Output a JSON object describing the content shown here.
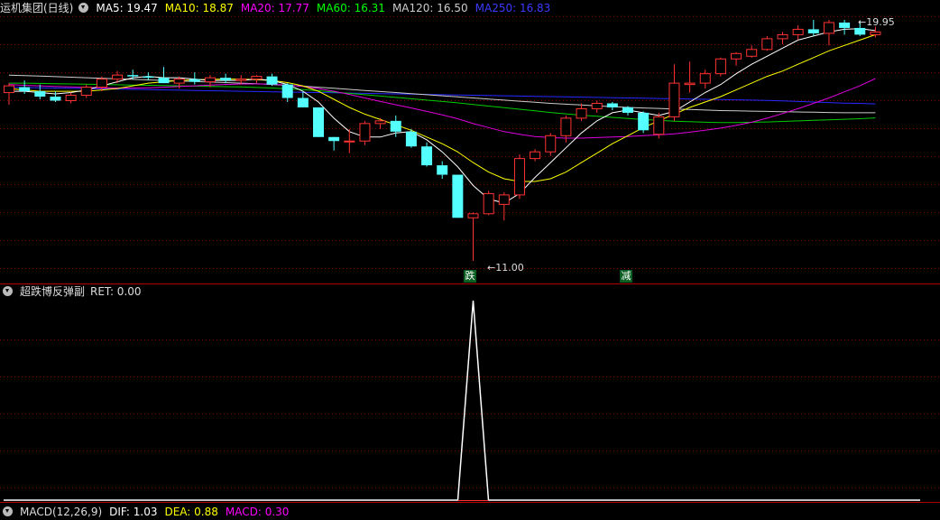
{
  "main_header": {
    "stock_name": "运机集团(日线)",
    "mas": [
      {
        "label": "MA5: 19.47",
        "color": "#ffffff"
      },
      {
        "label": "MA10: 18.87",
        "color": "#ffff00"
      },
      {
        "label": "MA20: 17.77",
        "color": "#ff00ff"
      },
      {
        "label": "MA60: 16.31",
        "color": "#00ff00"
      },
      {
        "label": "MA120: 16.50",
        "color": "#cccccc"
      },
      {
        "label": "MA250: 16.83",
        "color": "#3030ff"
      }
    ]
  },
  "annotations": {
    "high_label": "19.95",
    "low_label": "11.00",
    "signal_1": "跌",
    "signal_2": "减"
  },
  "indicator_header": {
    "name": "超跌博反弹副",
    "ret_label": "RET: 0.00"
  },
  "bottom_header": {
    "name": "MACD(12,26,9)",
    "dif": "DIF: 1.03",
    "dea": "DEA: 0.88",
    "macd": "MACD: 0.30"
  },
  "colors": {
    "up": "#ff3333",
    "down": "#54ffff",
    "grid": "#8b0000"
  },
  "candles": [
    [
      17.25,
      17.6,
      16.8,
      17.5
    ],
    [
      17.45,
      17.7,
      17.2,
      17.3
    ],
    [
      17.3,
      17.55,
      17.0,
      17.1
    ],
    [
      17.1,
      17.3,
      16.9,
      16.95
    ],
    [
      16.95,
      17.25,
      16.85,
      17.15
    ],
    [
      17.15,
      17.55,
      17.05,
      17.45
    ],
    [
      17.45,
      17.85,
      17.3,
      17.75
    ],
    [
      17.75,
      18.05,
      17.6,
      17.9
    ],
    [
      17.9,
      18.1,
      17.75,
      17.85
    ],
    [
      17.85,
      18.0,
      17.7,
      17.8
    ],
    [
      17.8,
      18.2,
      17.6,
      17.6
    ],
    [
      17.6,
      17.85,
      17.4,
      17.75
    ],
    [
      17.75,
      18.0,
      17.55,
      17.65
    ],
    [
      17.65,
      17.9,
      17.45,
      17.8
    ],
    [
      17.8,
      17.95,
      17.6,
      17.7
    ],
    [
      17.7,
      17.9,
      17.55,
      17.75
    ],
    [
      17.75,
      17.9,
      17.6,
      17.85
    ],
    [
      17.85,
      17.95,
      17.5,
      17.55
    ],
    [
      17.55,
      17.6,
      16.9,
      17.05
    ],
    [
      17.05,
      17.3,
      16.7,
      16.7
    ],
    [
      16.7,
      16.7,
      15.6,
      15.6
    ],
    [
      15.6,
      15.6,
      15.1,
      15.45
    ],
    [
      15.45,
      15.9,
      15.0,
      15.45
    ],
    [
      15.45,
      16.2,
      15.3,
      16.1
    ],
    [
      16.1,
      16.3,
      15.9,
      16.2
    ],
    [
      16.2,
      16.4,
      15.6,
      15.8
    ],
    [
      15.8,
      15.9,
      15.2,
      15.25
    ],
    [
      15.25,
      15.4,
      14.5,
      14.55
    ],
    [
      14.55,
      14.7,
      14.05,
      14.2
    ],
    [
      14.2,
      14.2,
      12.6,
      12.6
    ],
    [
      12.6,
      12.8,
      11.0,
      12.75
    ],
    [
      12.75,
      13.6,
      12.7,
      13.5
    ],
    [
      13.1,
      13.55,
      12.5,
      13.45
    ],
    [
      13.45,
      14.95,
      13.3,
      14.8
    ],
    [
      14.8,
      15.15,
      14.7,
      15.05
    ],
    [
      15.05,
      15.75,
      14.9,
      15.65
    ],
    [
      15.65,
      16.4,
      15.4,
      16.3
    ],
    [
      16.3,
      16.85,
      16.2,
      16.65
    ],
    [
      16.65,
      16.95,
      16.5,
      16.85
    ],
    [
      16.85,
      16.9,
      16.6,
      16.7
    ],
    [
      16.7,
      16.75,
      16.4,
      16.5
    ],
    [
      16.5,
      16.55,
      15.75,
      15.85
    ],
    [
      15.7,
      16.5,
      15.55,
      16.35
    ],
    [
      16.35,
      18.3,
      16.2,
      17.6
    ],
    [
      17.55,
      18.4,
      17.25,
      17.6
    ],
    [
      17.6,
      18.1,
      17.4,
      17.95
    ],
    [
      17.95,
      18.55,
      17.85,
      18.5
    ],
    [
      18.5,
      18.75,
      18.25,
      18.7
    ],
    [
      18.6,
      19.0,
      18.55,
      18.85
    ],
    [
      18.85,
      19.35,
      18.8,
      19.25
    ],
    [
      19.25,
      19.5,
      19.05,
      19.4
    ],
    [
      19.4,
      19.75,
      19.2,
      19.6
    ],
    [
      19.6,
      19.95,
      19.35,
      19.45
    ],
    [
      19.45,
      19.95,
      19.0,
      19.85
    ],
    [
      19.85,
      19.95,
      19.4,
      19.65
    ],
    [
      19.65,
      19.9,
      19.35,
      19.4
    ],
    [
      19.4,
      19.7,
      19.3,
      19.5
    ]
  ],
  "ma_lines": {
    "ma5": [
      17.3,
      17.3,
      17.25,
      17.2,
      17.25,
      17.35,
      17.5,
      17.65,
      17.8,
      17.85,
      17.8,
      17.8,
      17.75,
      17.7,
      17.7,
      17.7,
      17.75,
      17.7,
      17.55,
      17.3,
      16.9,
      16.3,
      15.8,
      15.6,
      15.6,
      15.75,
      15.8,
      15.5,
      15.05,
      14.5,
      13.8,
      13.3,
      13.15,
      13.5,
      14.1,
      14.65,
      15.2,
      15.75,
      16.2,
      16.5,
      16.6,
      16.5,
      16.4,
      16.55,
      16.9,
      17.25,
      17.55,
      17.95,
      18.3,
      18.6,
      18.9,
      19.2,
      19.35,
      19.5,
      19.6,
      19.62,
      19.55
    ],
    "ma10": [
      17.4,
      17.35,
      17.3,
      17.3,
      17.3,
      17.3,
      17.35,
      17.4,
      17.5,
      17.6,
      17.65,
      17.7,
      17.72,
      17.74,
      17.75,
      17.75,
      17.73,
      17.7,
      17.62,
      17.5,
      17.3,
      17.0,
      16.7,
      16.45,
      16.25,
      16.05,
      15.85,
      15.6,
      15.35,
      15.05,
      14.65,
      14.3,
      14.05,
      13.95,
      13.95,
      14.05,
      14.3,
      14.65,
      15.0,
      15.35,
      15.65,
      15.95,
      16.2,
      16.45,
      16.7,
      16.9,
      17.1,
      17.35,
      17.6,
      17.85,
      18.05,
      18.3,
      18.55,
      18.8,
      19.0,
      19.2,
      19.4
    ],
    "ma20": [
      17.55,
      17.52,
      17.5,
      17.48,
      17.46,
      17.44,
      17.43,
      17.42,
      17.42,
      17.43,
      17.45,
      17.48,
      17.5,
      17.53,
      17.55,
      17.57,
      17.57,
      17.56,
      17.53,
      17.48,
      17.4,
      17.3,
      17.18,
      17.05,
      16.92,
      16.8,
      16.68,
      16.55,
      16.42,
      16.28,
      16.1,
      15.95,
      15.8,
      15.7,
      15.62,
      15.58,
      15.56,
      15.56,
      15.58,
      15.6,
      15.62,
      15.65,
      15.68,
      15.72,
      15.78,
      15.85,
      15.93,
      16.03,
      16.15,
      16.3,
      16.47,
      16.65,
      16.85,
      17.05,
      17.28,
      17.5,
      17.77
    ],
    "ma60": [
      17.6,
      17.6,
      17.59,
      17.58,
      17.57,
      17.56,
      17.55,
      17.54,
      17.53,
      17.52,
      17.51,
      17.5,
      17.49,
      17.48,
      17.47,
      17.46,
      17.44,
      17.42,
      17.39,
      17.36,
      17.32,
      17.27,
      17.22,
      17.17,
      17.12,
      17.07,
      17.02,
      16.97,
      16.92,
      16.87,
      16.81,
      16.75,
      16.69,
      16.63,
      16.57,
      16.51,
      16.46,
      16.41,
      16.37,
      16.33,
      16.29,
      16.25,
      16.22,
      16.19,
      16.17,
      16.15,
      16.14,
      16.14,
      16.15,
      16.16,
      16.18,
      16.2,
      16.22,
      16.24,
      16.26,
      16.28,
      16.31
    ],
    "ma120": [
      17.9,
      17.88,
      17.86,
      17.84,
      17.82,
      17.8,
      17.78,
      17.76,
      17.74,
      17.72,
      17.7,
      17.68,
      17.66,
      17.64,
      17.62,
      17.6,
      17.58,
      17.55,
      17.52,
      17.49,
      17.45,
      17.41,
      17.37,
      17.33,
      17.29,
      17.25,
      17.21,
      17.17,
      17.13,
      17.09,
      17.05,
      17.01,
      16.97,
      16.93,
      16.89,
      16.85,
      16.82,
      16.79,
      16.76,
      16.73,
      16.7,
      16.68,
      16.66,
      16.64,
      16.62,
      16.6,
      16.58,
      16.57,
      16.56,
      16.55,
      16.54,
      16.53,
      16.52,
      16.51,
      16.5,
      16.5,
      16.5
    ],
    "ma250": [
      17.45,
      17.44,
      17.43,
      17.42,
      17.41,
      17.4,
      17.39,
      17.38,
      17.37,
      17.36,
      17.35,
      17.34,
      17.33,
      17.32,
      17.31,
      17.3,
      17.29,
      17.28,
      17.27,
      17.26,
      17.25,
      17.24,
      17.23,
      17.22,
      17.21,
      17.2,
      17.19,
      17.18,
      17.17,
      17.16,
      17.15,
      17.14,
      17.13,
      17.12,
      17.11,
      17.1,
      17.09,
      17.08,
      17.07,
      17.06,
      17.05,
      17.04,
      17.03,
      17.02,
      17.01,
      17.0,
      16.99,
      16.98,
      16.97,
      16.96,
      16.94,
      16.92,
      16.9,
      16.88,
      16.86,
      16.85,
      16.83
    ]
  },
  "ret_spike_index": 30
}
